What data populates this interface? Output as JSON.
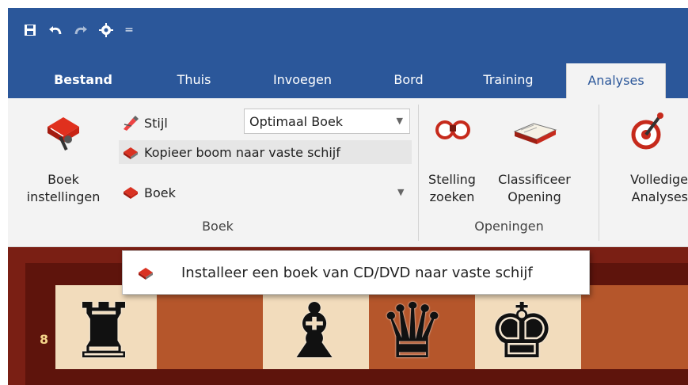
{
  "quick_access": {
    "icons": [
      "save-icon",
      "undo-icon",
      "redo-icon",
      "engine-icon",
      "customize-icon"
    ],
    "customize_glyph": "="
  },
  "tabs": [
    {
      "label": "Bestand",
      "active": false
    },
    {
      "label": "Thuis",
      "active": false
    },
    {
      "label": "Invoegen",
      "active": false
    },
    {
      "label": "Bord",
      "active": false
    },
    {
      "label": "Training",
      "active": false
    },
    {
      "label": "Analyses",
      "active": true
    }
  ],
  "ribbon": {
    "book_group": {
      "label": "Boek",
      "settings_line1": "Boek",
      "settings_line2": "instellingen",
      "style_label": "Stijl",
      "style_value": "Optimaal Boek",
      "copy_tree_label": "Kopieer boom naar vaste schijf",
      "book_label": "Boek"
    },
    "openings_group": {
      "label": "Openingen",
      "position_search_line1": "Stelling",
      "position_search_line2": "zoeken",
      "classify_line1": "Classificeer",
      "classify_line2": "Opening"
    },
    "analysis_group": {
      "full_line1": "Volledige",
      "full_line2": "Analyses"
    }
  },
  "popup": {
    "item_label": "Installeer een boek van CD/DVD naar vaste schijf"
  },
  "board": {
    "rank_label": "8",
    "pieces": [
      "rook",
      "bishop",
      "queen",
      "king"
    ]
  },
  "colors": {
    "title_bar": "#2b579a",
    "ribbon_bg": "#f3f3f3",
    "active_tab_text": "#2b579a",
    "board_frame": "#7a1f14",
    "light_square": "#f2dcbc",
    "dark_square": "#b5562b"
  }
}
